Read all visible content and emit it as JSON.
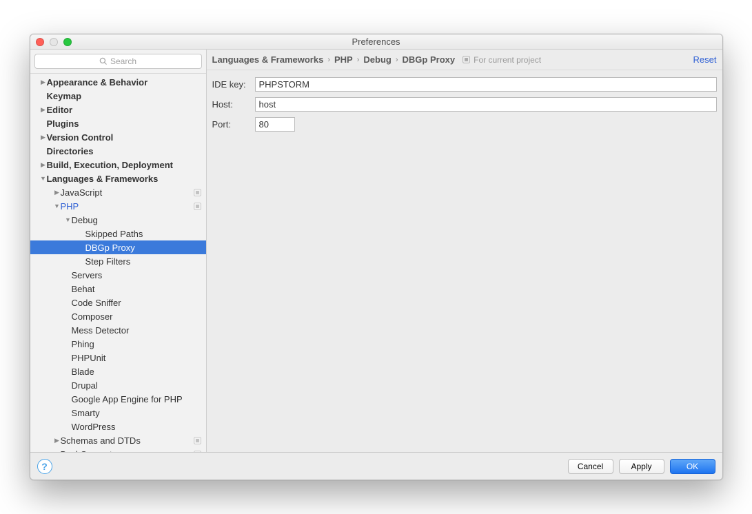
{
  "window": {
    "title": "Preferences"
  },
  "search": {
    "placeholder": "Search"
  },
  "tree": {
    "appearance": "Appearance & Behavior",
    "keymap": "Keymap",
    "editor": "Editor",
    "plugins": "Plugins",
    "vcs": "Version Control",
    "directories": "Directories",
    "build": "Build, Execution, Deployment",
    "languages": "Languages & Frameworks",
    "javascript": "JavaScript",
    "php": "PHP",
    "debug": "Debug",
    "skipped_paths": "Skipped Paths",
    "dbgp_proxy": "DBGp Proxy",
    "step_filters": "Step Filters",
    "servers": "Servers",
    "behat": "Behat",
    "code_sniffer": "Code Sniffer",
    "composer": "Composer",
    "mess_detector": "Mess Detector",
    "phing": "Phing",
    "phpunit": "PHPUnit",
    "blade": "Blade",
    "drupal": "Drupal",
    "gae": "Google App Engine for PHP",
    "smarty": "Smarty",
    "wordpress": "WordPress",
    "schemas": "Schemas and DTDs",
    "bashsupport": "BashSupport"
  },
  "breadcrumb": {
    "p0": "Languages & Frameworks",
    "p1": "PHP",
    "p2": "Debug",
    "p3": "DBGp Proxy",
    "scope": "For current project"
  },
  "actions": {
    "reset": "Reset"
  },
  "form": {
    "ide_key_label": "IDE key:",
    "ide_key_value": "PHPSTORM",
    "host_label": "Host:",
    "host_value": "host",
    "port_label": "Port:",
    "port_value": "80"
  },
  "footer": {
    "cancel": "Cancel",
    "apply": "Apply",
    "ok": "OK"
  }
}
